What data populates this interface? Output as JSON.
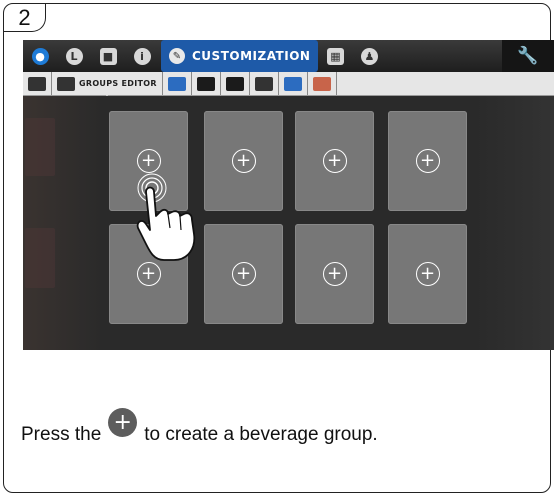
{
  "step": {
    "number": "2"
  },
  "topbar": {
    "icons": [
      "water-drop-icon",
      "clock-icon",
      "cup-icon",
      "info-icon"
    ],
    "active_tab_label": "CUSTOMIZATION",
    "right_icons": [
      "screen-icon",
      "user-icon"
    ],
    "settings_icon": "wrench-icon",
    "accent_color": "#1e5aa8"
  },
  "subbar": {
    "groups_editor_label": "GROUPS EDITOR",
    "items": [
      "book-icon",
      "groups-editor-icon",
      "book-blue-icon",
      "image-icon",
      "screensaver-icon",
      "volume-icon",
      "cup-stack-icon",
      "palette-icon"
    ]
  },
  "grid": {
    "tiles": [
      "+",
      "+",
      "+",
      "+",
      "+",
      "+",
      "+",
      "+"
    ]
  },
  "instruction": {
    "before": "Press the",
    "plus_glyph": "+",
    "after": "to create a beverage group."
  }
}
